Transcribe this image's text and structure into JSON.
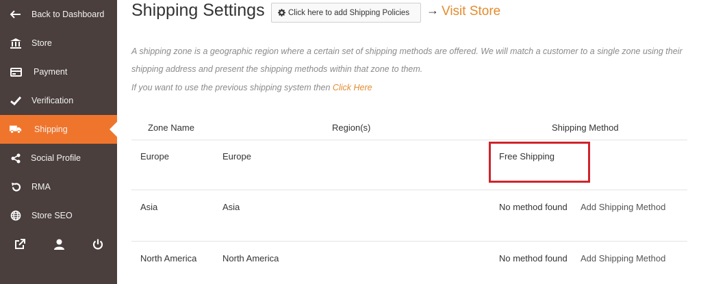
{
  "sidebar": {
    "items": [
      {
        "label": "Back to Dashboard",
        "icon": "arrow-left-icon"
      },
      {
        "label": "Store",
        "icon": "bank-icon"
      },
      {
        "label": "Payment",
        "icon": "credit-card-icon"
      },
      {
        "label": "Verification",
        "icon": "check-icon"
      },
      {
        "label": "Shipping",
        "icon": "truck-icon",
        "active": true
      },
      {
        "label": "Social Profile",
        "icon": "share-icon"
      },
      {
        "label": "RMA",
        "icon": "undo-icon"
      },
      {
        "label": "Store SEO",
        "icon": "globe-icon"
      }
    ],
    "bottom_icons": [
      "external-link-icon",
      "user-icon",
      "power-icon"
    ]
  },
  "header": {
    "title": "Shipping Settings",
    "policy_button_label": "Click here to add Shipping Policies",
    "arrow": "→",
    "visit_store_label": "Visit Store"
  },
  "intro": {
    "description": "A shipping zone is a geographic region where a certain set of shipping methods are offered. We will match a customer to a single zone using their shipping address and present the shipping methods within that zone to them.",
    "previous_text": "If you want to use the previous shipping system then ",
    "previous_link": "Click Here"
  },
  "table": {
    "headers": [
      "Zone Name",
      "Region(s)",
      "Shipping Method"
    ],
    "rows": [
      {
        "zone": "Europe",
        "region": "Europe",
        "method": "Free Shipping",
        "add_link": ""
      },
      {
        "zone": "Asia",
        "region": "Asia",
        "method": "No method found",
        "add_link": "Add Shipping Method"
      },
      {
        "zone": "North America",
        "region": "North America",
        "method": "No method found",
        "add_link": "Add Shipping Method"
      }
    ]
  },
  "colors": {
    "sidebar_bg": "#4a3f3d",
    "active_bg": "#f0752c",
    "accent": "#e38b2e",
    "highlight_border": "#d0232a"
  }
}
